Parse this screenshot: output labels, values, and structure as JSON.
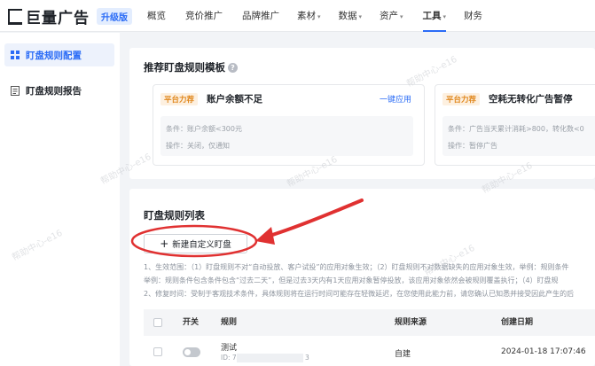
{
  "header": {
    "logo_text": "巨量广告",
    "version_badge": "升级版",
    "nav": [
      {
        "label": "概览"
      },
      {
        "label": "竞价推广"
      },
      {
        "label": "品牌推广"
      },
      {
        "label": "素材",
        "caret": "▾"
      },
      {
        "label": "数据",
        "caret": "▾"
      },
      {
        "label": "资产",
        "caret": "▾"
      },
      {
        "label": "工具",
        "caret": "▾",
        "active": true
      },
      {
        "label": "财务"
      }
    ]
  },
  "sidebar": {
    "items": [
      {
        "label": "盯盘规则配置",
        "icon": "grid-icon",
        "active": true
      },
      {
        "label": "盯盘规则报告",
        "icon": "report-icon"
      }
    ]
  },
  "templates": {
    "title": "推荐盯盘规则模板",
    "help": "?",
    "cards": [
      {
        "tag": "平台力荐",
        "name": "账户余额不足",
        "apply": "一键应用",
        "condition": "条件：账户余额<300元",
        "action": "操作：关闭，仅通知"
      },
      {
        "tag": "平台力荐",
        "name": "空耗无转化广告暂停",
        "apply": "",
        "condition": "条件：广告当天累计消耗>800，转化数<0",
        "action": "操作：暂停广告"
      }
    ]
  },
  "rules": {
    "title": "盯盘规则列表",
    "new_button": "新建自定义盯盘",
    "new_icon": "plus-icon",
    "notes": [
      "1、生效范围：（1）盯盘规则不对“自动投放、客户试投”的应用对象生效；（2）盯盘规则不对数据缺失的应用对象生效，举例：规则条件",
      "    举例：规则条件包含条件包含“过去二天”，但是过去3天内有1天应用对象暂停投放，该应用对象依然会被规则覆盖执行；（4）盯盘规",
      "2、修复时间：受制于客观技术条件，具体规则将在运行时间可能存在轻微延迟，在您使用此能力前，请您确认已知悉并接受因此产生的后"
    ],
    "columns": [
      "开关",
      "规则",
      "规则来源",
      "创建日期"
    ],
    "rows": [
      {
        "name": "测试",
        "id": "ID: 7",
        "id_tail": "3",
        "source": "自建",
        "created": "2024-01-18 17:07:46"
      }
    ]
  },
  "watermark": "帮助中心-e16"
}
